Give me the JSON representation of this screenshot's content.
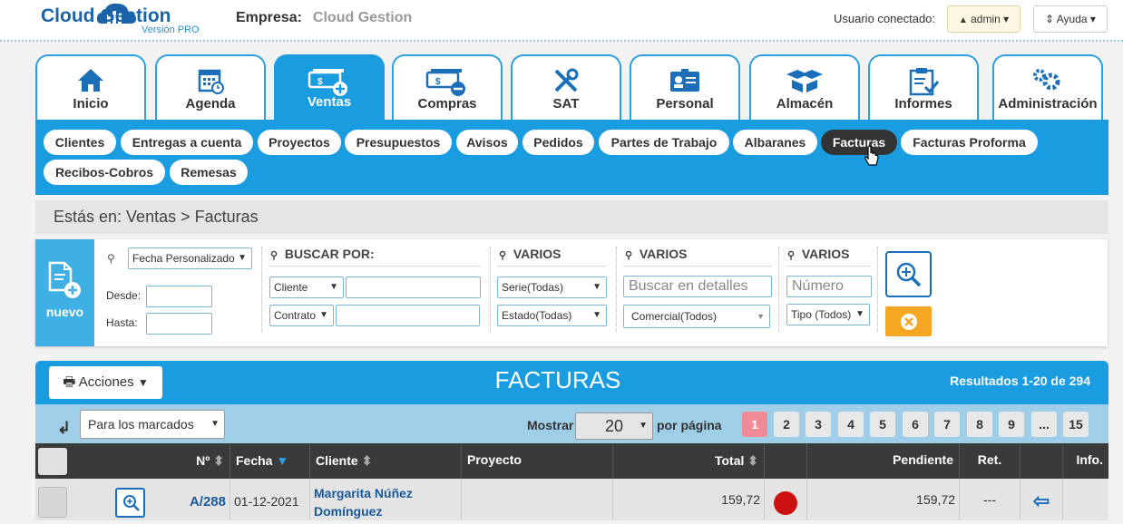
{
  "brand": {
    "name": "Cloud Gestion",
    "version": "Versión PRO"
  },
  "header": {
    "empresa_label": "Empresa:",
    "empresa_value": "Cloud Gestion",
    "usuario_label": "Usuario conectado:",
    "admin_label": "admin",
    "ayuda_label": "Ayuda"
  },
  "tabs": [
    {
      "label": "Inicio"
    },
    {
      "label": "Agenda"
    },
    {
      "label": "Ventas"
    },
    {
      "label": "Compras"
    },
    {
      "label": "SAT"
    },
    {
      "label": "Personal"
    },
    {
      "label": "Almacén"
    },
    {
      "label": "Informes"
    },
    {
      "label": "Administración"
    }
  ],
  "active_tab": "Ventas",
  "subnav": [
    "Clientes",
    "Entregas a cuenta",
    "Proyectos",
    "Presupuestos",
    "Avisos",
    "Pedidos",
    "Partes de Trabajo",
    "Albaranes",
    "Facturas",
    "Facturas Proforma",
    "Recibos-Cobros",
    "Remesas"
  ],
  "active_subnav": "Facturas",
  "breadcrumb": "Estás en: Ventas > Facturas",
  "filters": {
    "nuevo_label": "nuevo",
    "date_filter": "Fecha Personalizado",
    "desde_label": "Desde:",
    "hasta_label": "Hasta:",
    "buscar_por": "BUSCAR POR:",
    "cliente_select": "Cliente",
    "contrato_select": "Contrato",
    "varios_1": "VARIOS",
    "serie": "Serie(Todas)",
    "estado": "Estado(Todas)",
    "varios_2": "VARIOS",
    "detalles_placeholder": "Buscar en detalles",
    "comercial": "Comercial(Todos)",
    "varios_3": "VARIOS",
    "numero_placeholder": "Número",
    "tipo": "Tipo (Todos)"
  },
  "list": {
    "acciones_label": "Acciones",
    "title": "FACTURAS",
    "results": "Resultados 1-20 de 294",
    "marcados": "Para los marcados",
    "mostrar": "Mostrar",
    "per_page": "20",
    "por_pagina": "por página",
    "pages": [
      "1",
      "2",
      "3",
      "4",
      "5",
      "6",
      "7",
      "8",
      "9",
      "...",
      "15"
    ],
    "current_page": "1"
  },
  "table": {
    "headers": {
      "num": "Nº",
      "fecha": "Fecha",
      "cliente": "Cliente",
      "proyecto": "Proyecto",
      "total": "Total",
      "pendiente": "Pendiente",
      "ret": "Ret.",
      "info": "Info."
    },
    "rows": [
      {
        "num": "A/288",
        "fecha": "01-12-2021",
        "cliente_1": "Margarita Núñez",
        "cliente_2": "Domínguez",
        "proyecto": "",
        "total": "159,72",
        "status_color": "#cc1111",
        "pendiente": "159,72",
        "ret": "---"
      }
    ]
  },
  "colors": {
    "primary": "#1a9ce0",
    "dark": "#333333",
    "accent": "#f5a623",
    "current_page": "#f08a96"
  }
}
